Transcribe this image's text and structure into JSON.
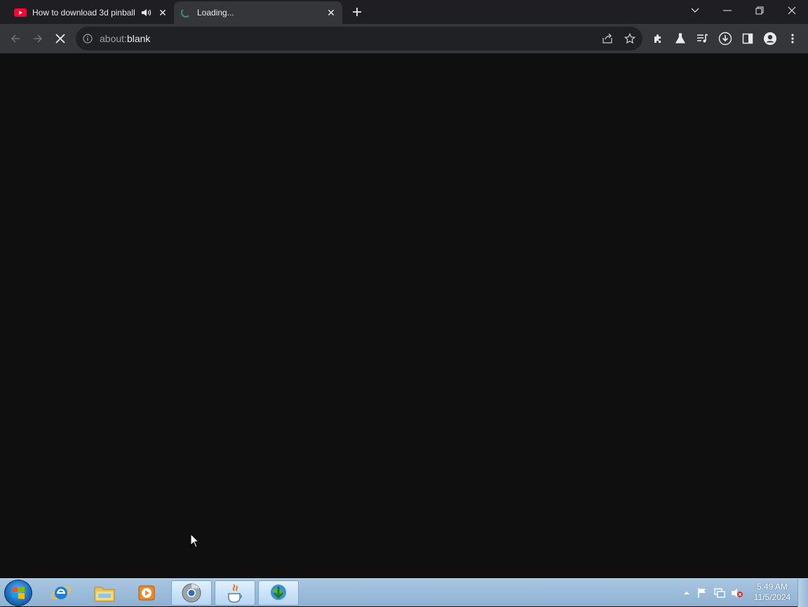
{
  "tabs": [
    {
      "title": "How to download 3d pinball",
      "favicon": "youtube-icon",
      "audio": "audio-playing-icon",
      "active": false
    },
    {
      "title": "Loading...",
      "favicon": "loading-spinner-icon",
      "active": true
    }
  ],
  "omnibox": {
    "scheme": "about:",
    "path": "blank"
  },
  "taskbar": {
    "apps": [
      "internet-explorer",
      "file-explorer",
      "media-player",
      "chrome",
      "java",
      "internet-download-manager"
    ],
    "clock": {
      "time": "5:49 AM",
      "date": "11/5/2024"
    }
  },
  "colors": {
    "page_background": "#0f0f0f",
    "tabstrip": "#1f1f23",
    "toolbar": "#35363a",
    "youtube_red": "#ff0033"
  }
}
